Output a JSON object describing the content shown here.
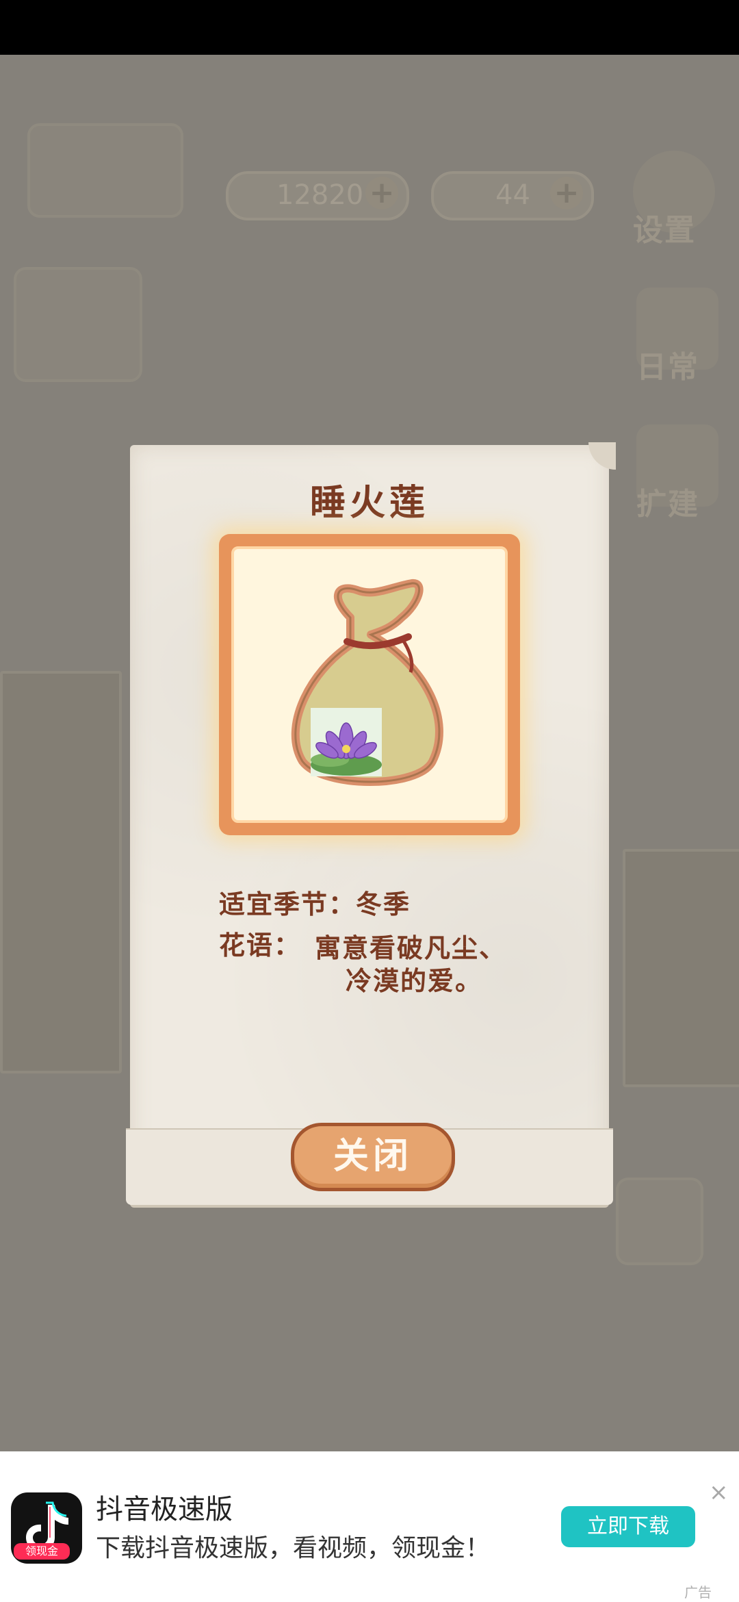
{
  "hud": {
    "fish_count": "12820",
    "cake_count": "44",
    "settings_label": "设置",
    "daily_label": "日常",
    "expand_label": "扩建"
  },
  "modal": {
    "title": "睡火莲",
    "season_line": "适宜季节：冬季",
    "language_label": "花语：",
    "language_line1": "寓意看破凡尘、",
    "language_line2": "冷漠的爱。",
    "close_label": "关闭"
  },
  "ad": {
    "badge": "领现金",
    "title": "抖音极速版",
    "description": "下载抖音极速版，看视频，领现金！",
    "cta": "立即下载",
    "close_icon": "×",
    "tag": "广告"
  },
  "colors": {
    "title_brown": "#7a3a22",
    "frame_orange": "#e7945b",
    "cta_teal": "#1fc3c3"
  }
}
